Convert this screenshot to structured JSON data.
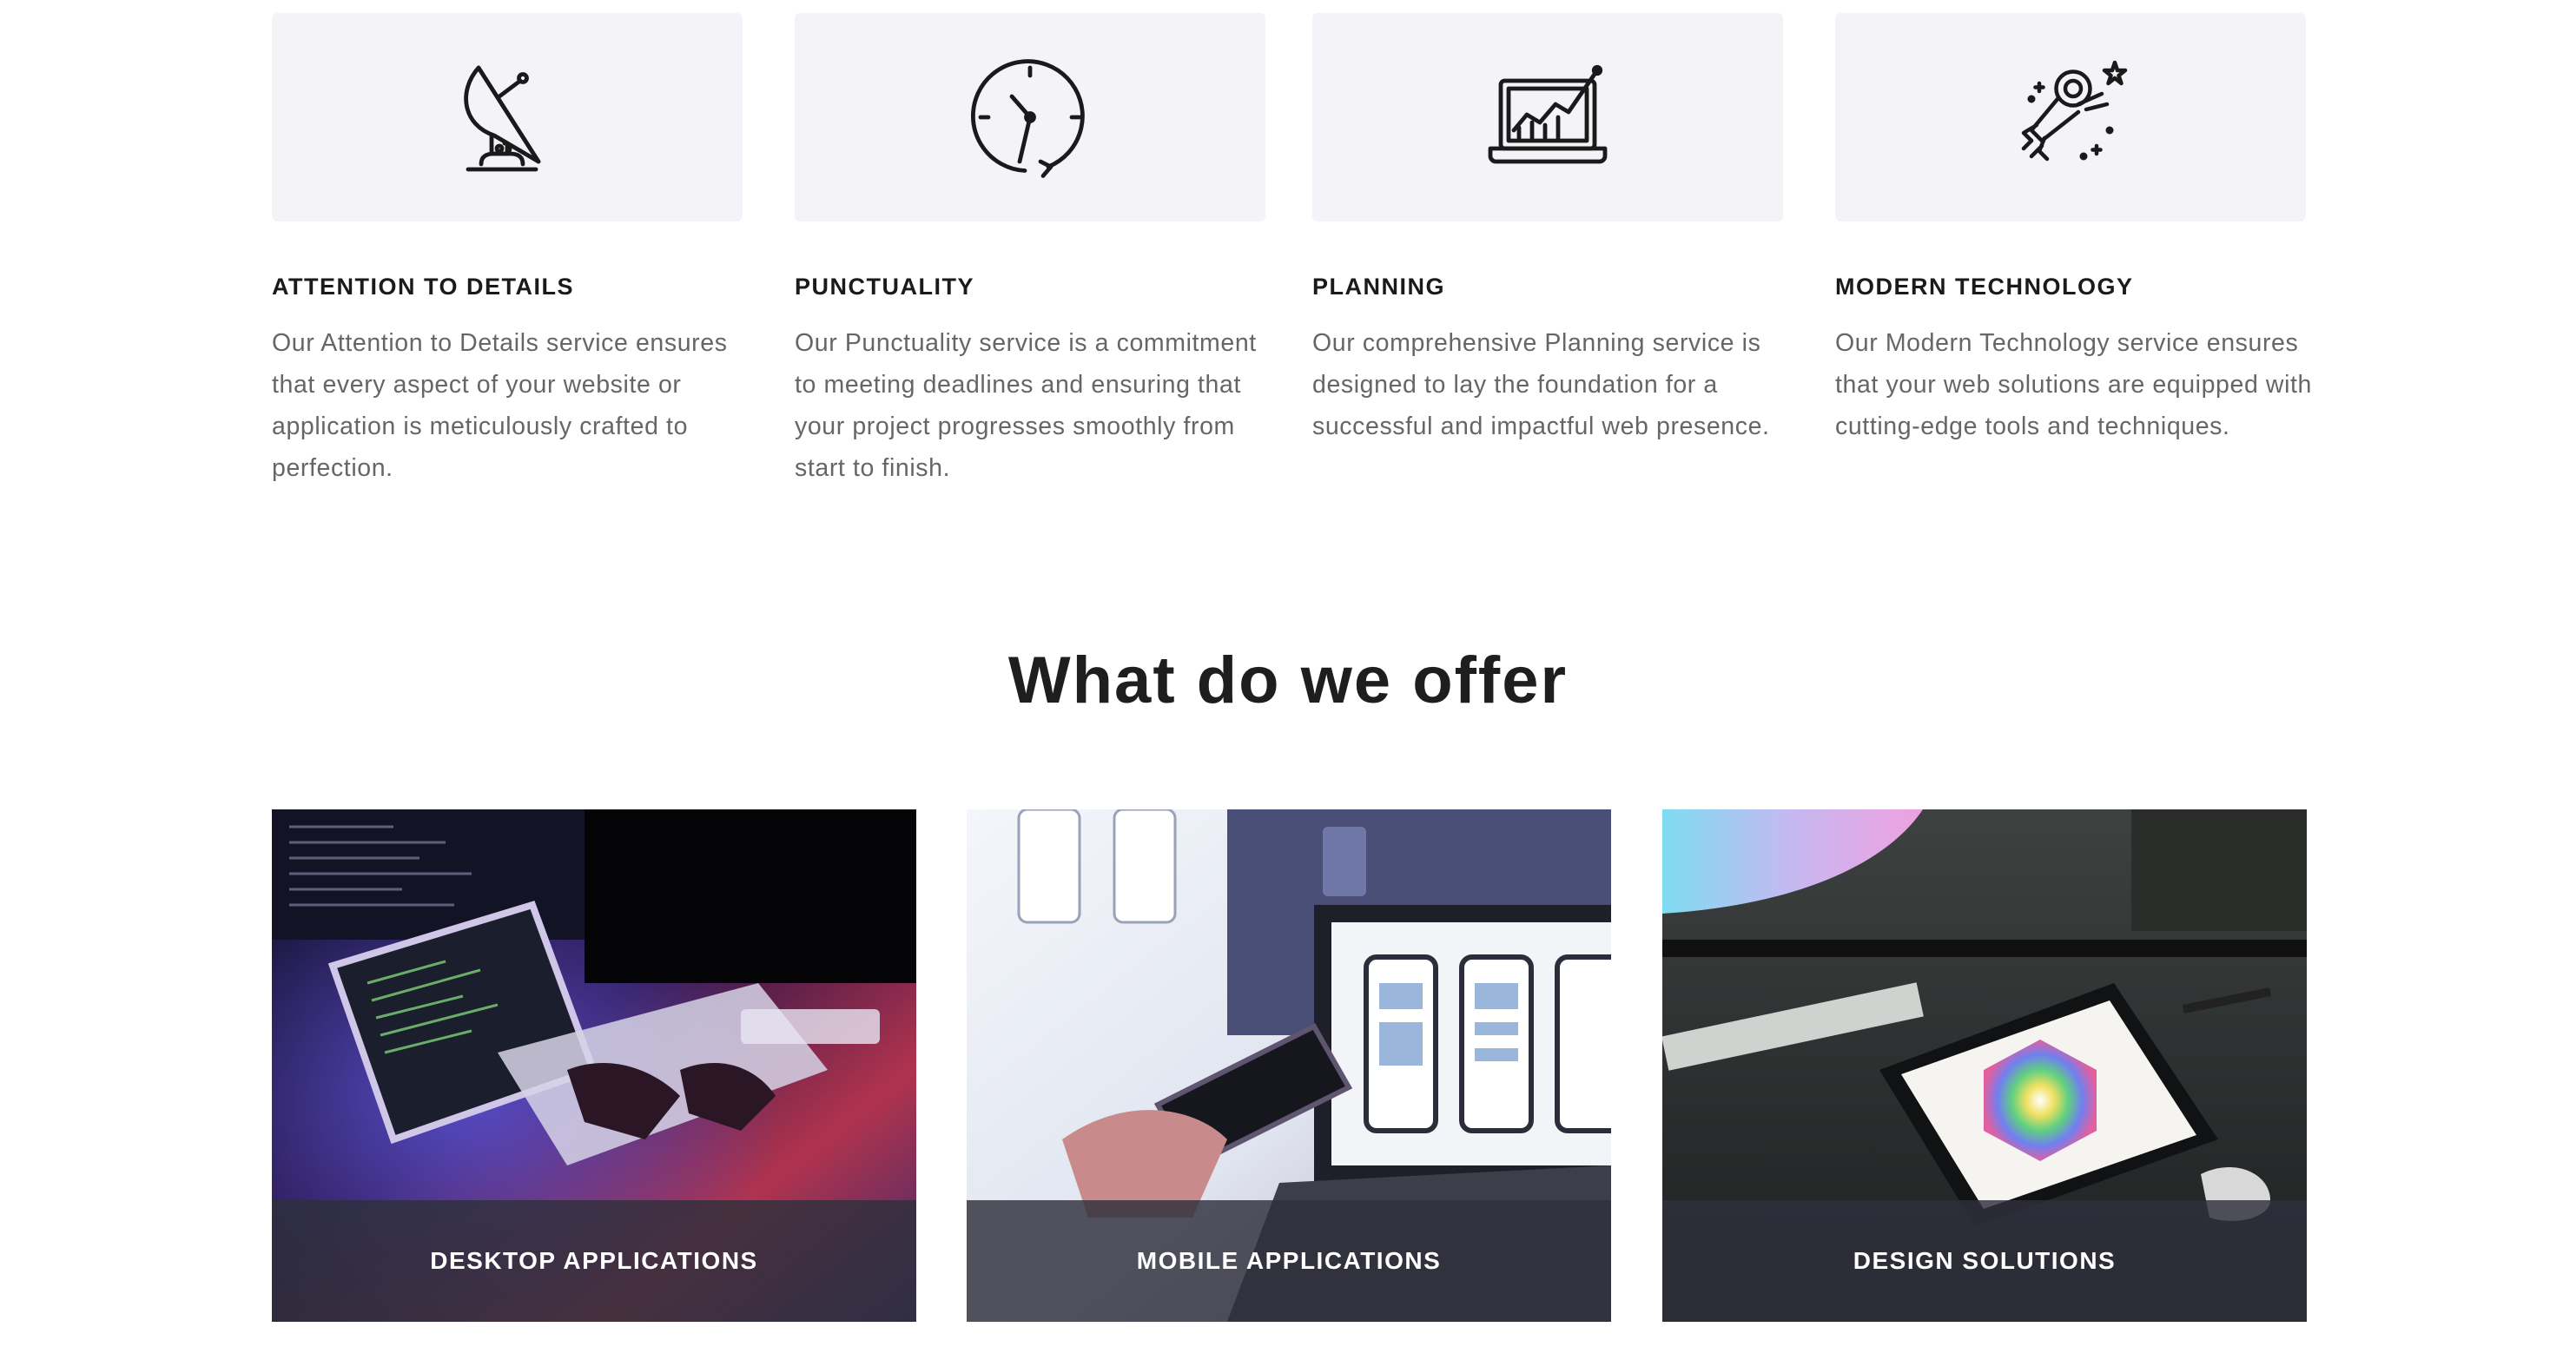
{
  "features": [
    {
      "icon": "satellite-dish-icon",
      "title": "ATTENTION TO DETAILS",
      "text": "Our Attention to Details service ensures that every aspect of your website or application is meticulously crafted to perfection."
    },
    {
      "icon": "clock-icon",
      "title": "PUNCTUALITY",
      "text": "Our Punctuality service is a commitment to meeting deadlines and ensuring that your project progresses smoothly from start to finish."
    },
    {
      "icon": "laptop-chart-icon",
      "title": "PLANNING",
      "text": "Our comprehensive Planning service is designed to lay the foundation for a successful and impactful web presence."
    },
    {
      "icon": "astronaut-rocket-icon",
      "title": "MODERN TECHNOLOGY",
      "text": "Our Modern Technology service ensures that your web solutions are equipped with cutting-edge tools and techniques."
    }
  ],
  "offer": {
    "title": "What do we offer",
    "cards": [
      {
        "label": "DESKTOP APPLICATIONS",
        "image": "developer-tablet-photo"
      },
      {
        "label": "MOBILE APPLICATIONS",
        "image": "mobile-wireframes-photo"
      },
      {
        "label": "DESIGN SOLUTIONS",
        "image": "color-palette-tablet-photo"
      }
    ]
  },
  "colors": {
    "tile_background": "#f4f4f8",
    "caption_overlay": "#2e303c",
    "body_text": "#666666",
    "heading_text": "#1a1a1a"
  }
}
